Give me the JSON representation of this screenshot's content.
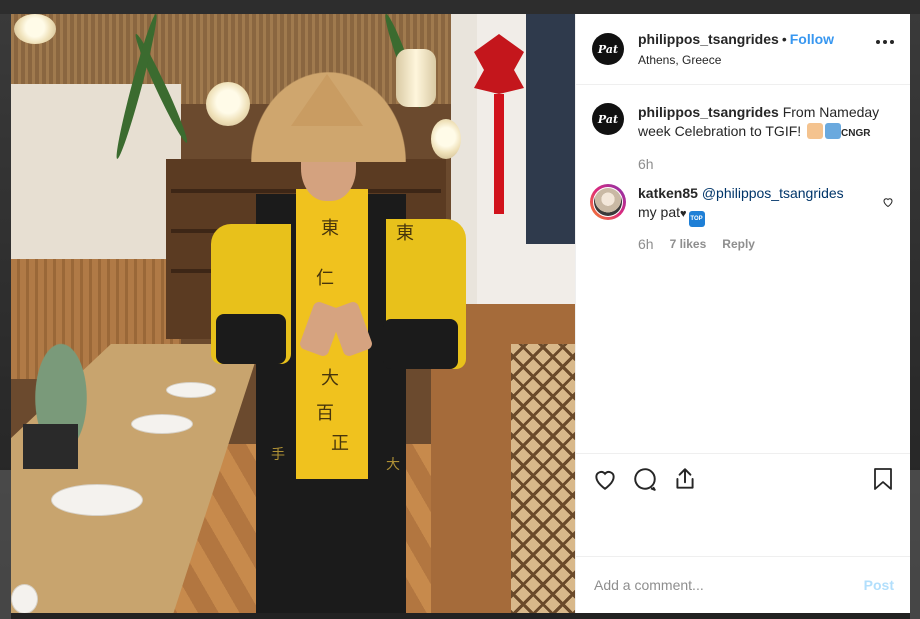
{
  "post": {
    "username": "philippos_tsangrides",
    "avatar_text": "Pat",
    "follow_label": "Follow",
    "separator": "•",
    "location": "Athens, Greece",
    "caption": {
      "username": "philippos_tsangrides",
      "text_line1": "From Nameday",
      "text_line2": "week Celebration to TGIF!",
      "emoji_tag": "CNGR",
      "time": "6h"
    },
    "comments": [
      {
        "username": "katken85",
        "mention": "@philippos_tsangrides",
        "text": "my pat",
        "emoji_badge": "TOP",
        "time": "6h",
        "likes": "7 likes",
        "reply_label": "Reply"
      }
    ],
    "add_comment_placeholder": "Add a comment...",
    "post_label": "Post"
  },
  "photo": {
    "glyphs": [
      "東",
      "仁",
      "大",
      "百",
      "正",
      "東",
      "手",
      "大"
    ]
  },
  "icons": {
    "more": "more-options-icon",
    "like": "heart-icon",
    "comment": "comment-icon",
    "share": "share-icon",
    "save": "bookmark-icon",
    "comment_like": "small-heart-icon"
  },
  "colors": {
    "link": "#3897f0",
    "text": "#262626",
    "muted": "#8e8e8e",
    "post_disabled": "#b2dffc",
    "story_ring": "#dd2a7b"
  }
}
